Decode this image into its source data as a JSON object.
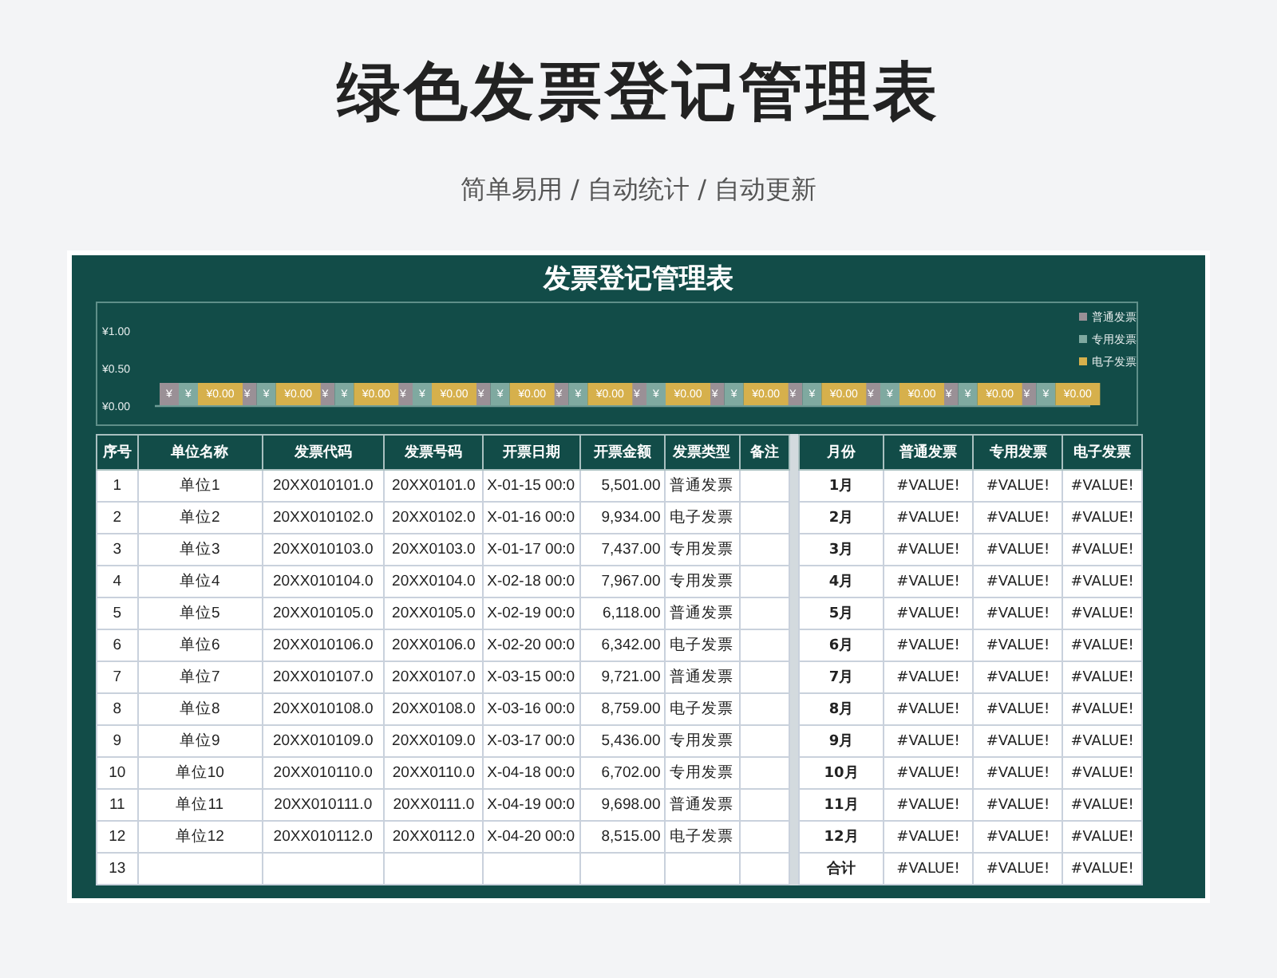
{
  "page": {
    "title": "绿色发票登记管理表",
    "subtitle": "简单易用 / 自动统计 / 自动更新"
  },
  "sheet": {
    "title": "发票登记管理表",
    "chart_data": {
      "type": "bar",
      "legend": "top-right",
      "ylim": [
        0,
        1
      ],
      "yticks": [
        {
          "value": 0,
          "label": "¥0.00"
        },
        {
          "value": 0.5,
          "label": "¥0.50"
        },
        {
          "value": 1,
          "label": "¥1.00"
        }
      ],
      "series": [
        {
          "name": "普通发票",
          "color": "#9a9096",
          "values": [
            0,
            0,
            0,
            0,
            0,
            0,
            0,
            0,
            0,
            0,
            0,
            0
          ],
          "value_labels": [
            "¥",
            "¥",
            "¥",
            "¥",
            "¥",
            "¥",
            "¥",
            "¥",
            "¥",
            "¥",
            "¥",
            "¥"
          ]
        },
        {
          "name": "专用发票",
          "color": "#7fa9a0",
          "values": [
            0,
            0,
            0,
            0,
            0,
            0,
            0,
            0,
            0,
            0,
            0,
            0
          ],
          "value_labels": [
            "¥",
            "¥",
            "¥",
            "¥",
            "¥",
            "¥",
            "¥",
            "¥",
            "¥",
            "¥",
            "¥",
            "¥"
          ]
        },
        {
          "name": "电子发票",
          "color": "#d6b04c",
          "values": [
            0,
            0,
            0,
            0,
            0,
            0,
            0,
            0,
            0,
            0,
            0,
            0
          ],
          "value_labels": [
            "¥0.00",
            "¥0.00",
            "¥0.00",
            "¥0.00",
            "¥0.00",
            "¥0.00",
            "¥0.00",
            "¥0.00",
            "¥0.00",
            "¥0.00",
            "¥0.00",
            "¥0.00"
          ]
        }
      ]
    },
    "register": {
      "columns": [
        "序号",
        "单位名称",
        "发票代码",
        "发票号码",
        "开票日期",
        "开票金额",
        "发票类型",
        "备注"
      ],
      "rows": [
        [
          "1",
          "单位1",
          "20XX010101.0",
          "20XX0101.0",
          "X-01-15 00:0",
          "5,501.00",
          "普通发票"
        ],
        [
          "2",
          "单位2",
          "20XX010102.0",
          "20XX0102.0",
          "X-01-16 00:0",
          "9,934.00",
          "电子发票"
        ],
        [
          "3",
          "单位3",
          "20XX010103.0",
          "20XX0103.0",
          "X-01-17 00:0",
          "7,437.00",
          "专用发票"
        ],
        [
          "4",
          "单位4",
          "20XX010104.0",
          "20XX0104.0",
          "X-02-18 00:0",
          "7,967.00",
          "专用发票"
        ],
        [
          "5",
          "单位5",
          "20XX010105.0",
          "20XX0105.0",
          "X-02-19 00:0",
          "6,118.00",
          "普通发票"
        ],
        [
          "6",
          "单位6",
          "20XX010106.0",
          "20XX0106.0",
          "X-02-20 00:0",
          "6,342.00",
          "电子发票"
        ],
        [
          "7",
          "单位7",
          "20XX010107.0",
          "20XX0107.0",
          "X-03-15 00:0",
          "9,721.00",
          "普通发票"
        ],
        [
          "8",
          "单位8",
          "20XX010108.0",
          "20XX0108.0",
          "X-03-16 00:0",
          "8,759.00",
          "电子发票"
        ],
        [
          "9",
          "单位9",
          "20XX010109.0",
          "20XX0109.0",
          "X-03-17 00:0",
          "5,436.00",
          "专用发票"
        ],
        [
          "10",
          "单位10",
          "20XX010110.0",
          "20XX0110.0",
          "X-04-18 00:0",
          "6,702.00",
          "专用发票"
        ],
        [
          "11",
          "单位11",
          "20XX010111.0",
          "20XX0111.0",
          "X-04-19 00:0",
          "9,698.00",
          "普通发票"
        ],
        [
          "12",
          "单位12",
          "20XX010112.0",
          "20XX0112.0",
          "X-04-20 00:0",
          "8,515.00",
          "电子发票"
        ],
        [
          "13"
        ]
      ]
    },
    "summary": {
      "columns": [
        "月份",
        "普通发票",
        "专用发票",
        "电子发票"
      ],
      "rows": [
        [
          "1月",
          "#VALUE!",
          "#VALUE!",
          "#VALUE!"
        ],
        [
          "2月",
          "#VALUE!",
          "#VALUE!",
          "#VALUE!"
        ],
        [
          "3月",
          "#VALUE!",
          "#VALUE!",
          "#VALUE!"
        ],
        [
          "4月",
          "#VALUE!",
          "#VALUE!",
          "#VALUE!"
        ],
        [
          "5月",
          "#VALUE!",
          "#VALUE!",
          "#VALUE!"
        ],
        [
          "6月",
          "#VALUE!",
          "#VALUE!",
          "#VALUE!"
        ],
        [
          "7月",
          "#VALUE!",
          "#VALUE!",
          "#VALUE!"
        ],
        [
          "8月",
          "#VALUE!",
          "#VALUE!",
          "#VALUE!"
        ],
        [
          "9月",
          "#VALUE!",
          "#VALUE!",
          "#VALUE!"
        ],
        [
          "10月",
          "#VALUE!",
          "#VALUE!",
          "#VALUE!"
        ],
        [
          "11月",
          "#VALUE!",
          "#VALUE!",
          "#VALUE!"
        ],
        [
          "12月",
          "#VALUE!",
          "#VALUE!",
          "#VALUE!"
        ],
        [
          "合计",
          "#VALUE!",
          "#VALUE!",
          "#VALUE!"
        ]
      ]
    }
  }
}
